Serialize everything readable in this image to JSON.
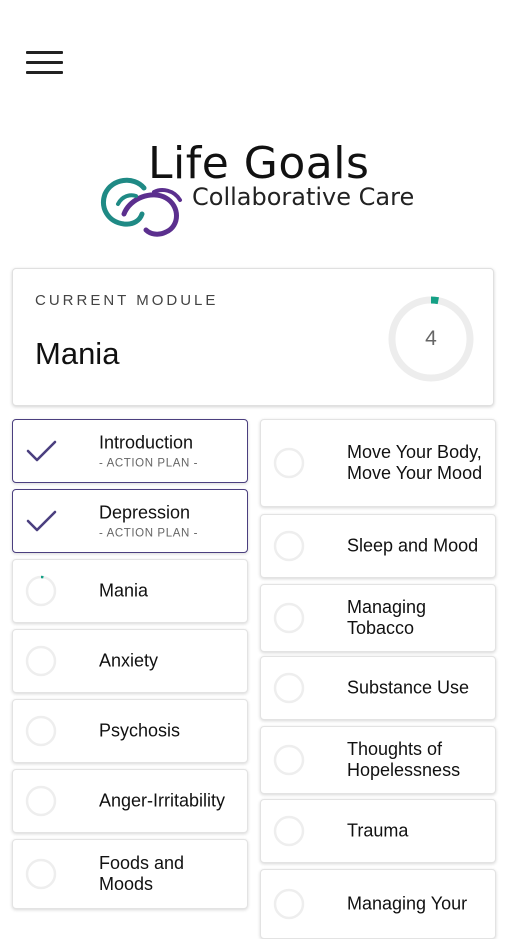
{
  "header": {
    "menu_icon": "hamburger-menu-icon"
  },
  "logo": {
    "title": "Life Goals",
    "subtitle": "Collaborative Care",
    "colors": {
      "teal": "#1f8a85",
      "purple": "#5b2f8e"
    }
  },
  "current_module": {
    "label": "CURRENT MODULE",
    "name": "Mania",
    "count": "4",
    "progress_fraction": 0.03,
    "ring_color": "#14a085"
  },
  "accent_color": "#4b3f7f",
  "modules_left": [
    {
      "title": "Introduction",
      "subtitle": "- ACTION PLAN -",
      "status": "done"
    },
    {
      "title": "Depression",
      "subtitle": "- ACTION PLAN -",
      "status": "done"
    },
    {
      "title": "Mania",
      "subtitle": "",
      "status": "in-progress"
    },
    {
      "title": "Anxiety",
      "subtitle": "",
      "status": "none"
    },
    {
      "title": "Psychosis",
      "subtitle": "",
      "status": "none"
    },
    {
      "title": "Anger-Irritability",
      "subtitle": "",
      "status": "none"
    },
    {
      "title": "Foods and Moods",
      "subtitle": "",
      "status": "none"
    }
  ],
  "modules_right": [
    {
      "title": "Move Your Body, Move Your Mood",
      "subtitle": "",
      "status": "none"
    },
    {
      "title": "Sleep and Mood",
      "subtitle": "",
      "status": "none"
    },
    {
      "title": "Managing Tobacco",
      "subtitle": "",
      "status": "none"
    },
    {
      "title": "Substance Use",
      "subtitle": "",
      "status": "none"
    },
    {
      "title": "Thoughts of Hopelessness",
      "subtitle": "",
      "status": "none"
    },
    {
      "title": "Trauma",
      "subtitle": "",
      "status": "none"
    },
    {
      "title": "Managing Your",
      "subtitle": "",
      "status": "none"
    }
  ]
}
